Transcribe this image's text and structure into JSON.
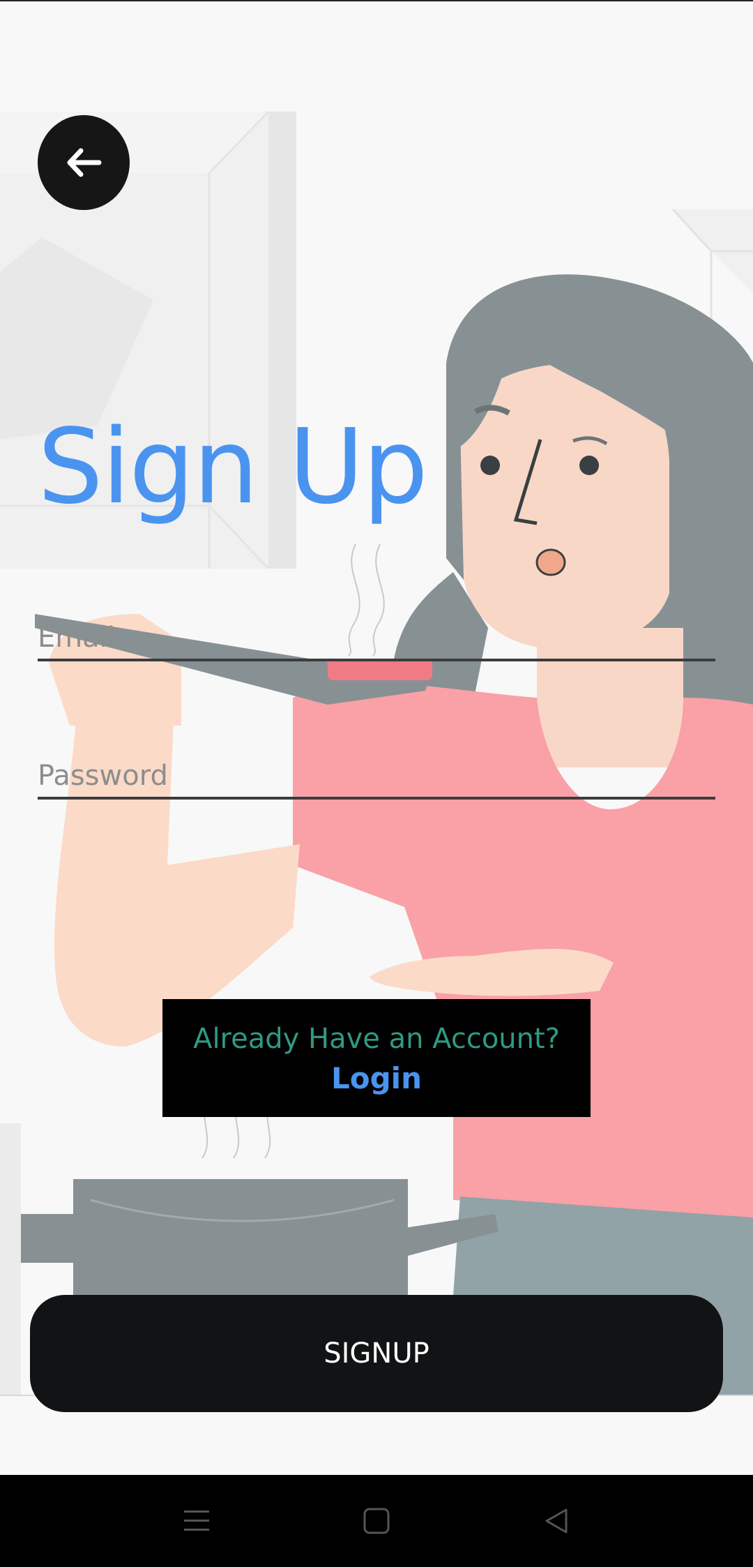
{
  "colors": {
    "accent": "#4a94f0",
    "hint_green": "#2f9a82",
    "background": "#f8f8f8",
    "button_dark": "#121314"
  },
  "header": {
    "back_icon": "arrow-left-icon"
  },
  "page": {
    "title": "Sign Up"
  },
  "form": {
    "email_placeholder": "Email",
    "email_value": "",
    "password_placeholder": "Password",
    "password_value": ""
  },
  "account": {
    "question": "Already Have an Account?",
    "login_label": "Login"
  },
  "actions": {
    "signup_label": "SIGNUP"
  },
  "navbar": {
    "icons": [
      "menu-icon",
      "home-square-icon",
      "back-triangle-icon"
    ]
  }
}
